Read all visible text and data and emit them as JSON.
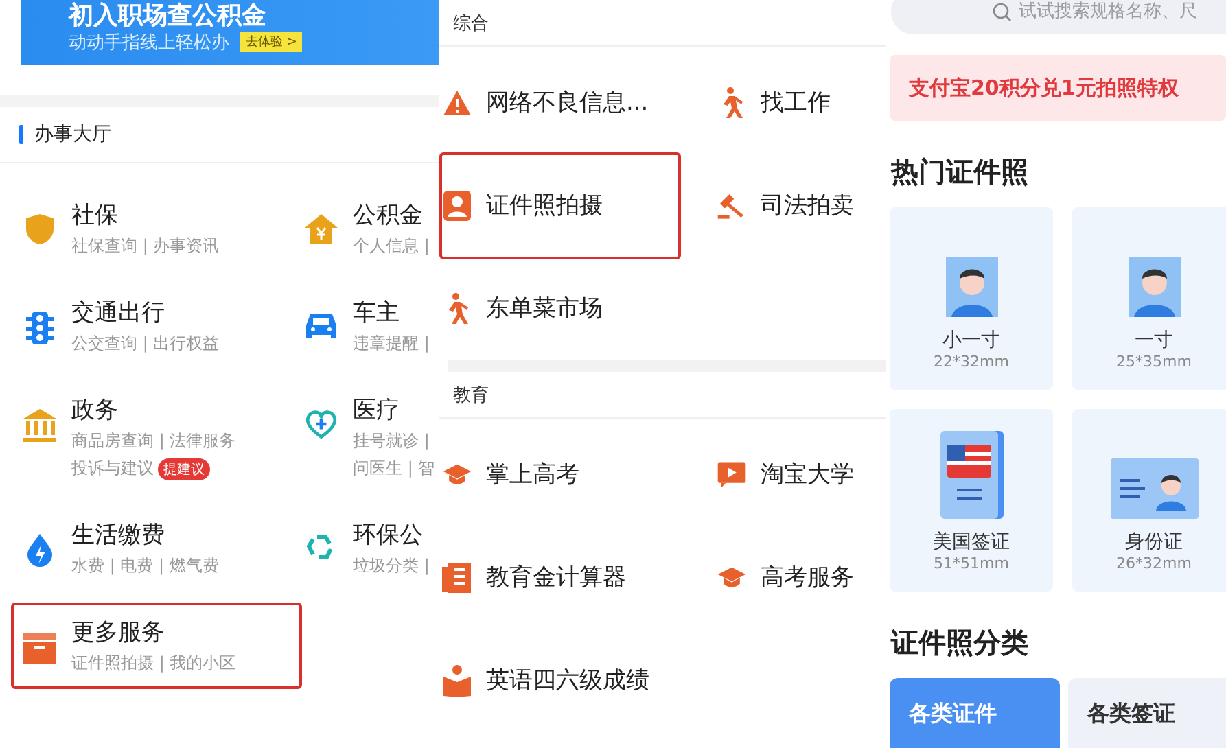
{
  "left_panel": {
    "banner": {
      "title": "初入职场查公积金",
      "subtitle": "动动手指线上轻松办",
      "button": "去体验 >"
    },
    "section_title": "办事大厅",
    "services": [
      {
        "title": "社保",
        "kind": "shield",
        "highlighted": false,
        "lines": [
          {
            "text": "社保查询 | 办事资讯"
          }
        ]
      },
      {
        "title": "公积金",
        "kind": "house",
        "highlighted": false,
        "lines": [
          {
            "text": "个人信息 |"
          }
        ]
      },
      {
        "title": "交通出行",
        "kind": "traffic",
        "highlighted": false,
        "lines": [
          {
            "text": "公交查询 | 出行权益"
          }
        ]
      },
      {
        "title": "车主",
        "kind": "car",
        "highlighted": false,
        "lines": [
          {
            "text": "违章提醒 |"
          }
        ]
      },
      {
        "title": "政务",
        "kind": "bank",
        "highlighted": false,
        "lines": [
          {
            "text": "商品房查询 | 法律服务"
          },
          {
            "text": "投诉与建议",
            "badge": "提建议"
          }
        ]
      },
      {
        "title": "医疗",
        "kind": "medical",
        "highlighted": false,
        "lines": [
          {
            "text": "挂号就诊 |"
          },
          {
            "text": "问医生 | 智"
          }
        ]
      },
      {
        "title": "生活缴费",
        "kind": "drop",
        "highlighted": false,
        "lines": [
          {
            "text": "水费 | 电费 | 燃气费"
          }
        ]
      },
      {
        "title": "环保公",
        "kind": "recycle",
        "highlighted": false,
        "lines": [
          {
            "text": "垃圾分类 |"
          }
        ]
      },
      {
        "title": "更多服务",
        "kind": "box",
        "highlighted": true,
        "lines": [
          {
            "text": "证件照拍摄 | 我的小区"
          }
        ]
      }
    ]
  },
  "middle_panel": {
    "sections": [
      {
        "title": "综合",
        "items": [
          {
            "label": "网络不良信息...",
            "kind": "warning",
            "highlighted": false
          },
          {
            "label": "找工作",
            "kind": "walker",
            "highlighted": false
          },
          {
            "label": "证件照拍摄",
            "kind": "person",
            "highlighted": true
          },
          {
            "label": "司法拍卖",
            "kind": "gavel",
            "highlighted": false
          },
          {
            "label": "东单菜市场",
            "kind": "walker",
            "highlighted": false
          }
        ]
      },
      {
        "title": "教育",
        "items": [
          {
            "label": "掌上高考",
            "kind": "cap",
            "highlighted": false
          },
          {
            "label": "淘宝大学",
            "kind": "video",
            "highlighted": false
          },
          {
            "label": "教育金计算器",
            "kind": "book",
            "highlighted": false
          },
          {
            "label": "高考服务",
            "kind": "cap",
            "highlighted": false
          },
          {
            "label": "英语四六级成绩",
            "kind": "reader",
            "highlighted": false
          }
        ]
      }
    ]
  },
  "right_panel": {
    "search": {
      "placeholder": "试试搜索规格名称、尺"
    },
    "promo": "支付宝20积分兑1元拍照特权",
    "popular_title": "热门证件照",
    "photo_cards": [
      {
        "name": "小一寸",
        "size": "22*32mm",
        "kind": "portrait"
      },
      {
        "name": "一寸",
        "size": "25*35mm",
        "kind": "portrait"
      },
      {
        "name": "美国签证",
        "size": "51*51mm",
        "kind": "visa"
      },
      {
        "name": "身份证",
        "size": "26*32mm",
        "kind": "idcard"
      }
    ],
    "category_title": "证件照分类",
    "categories": [
      {
        "label": "各类证件",
        "selected": true
      },
      {
        "label": "各类签证",
        "selected": false
      }
    ]
  }
}
